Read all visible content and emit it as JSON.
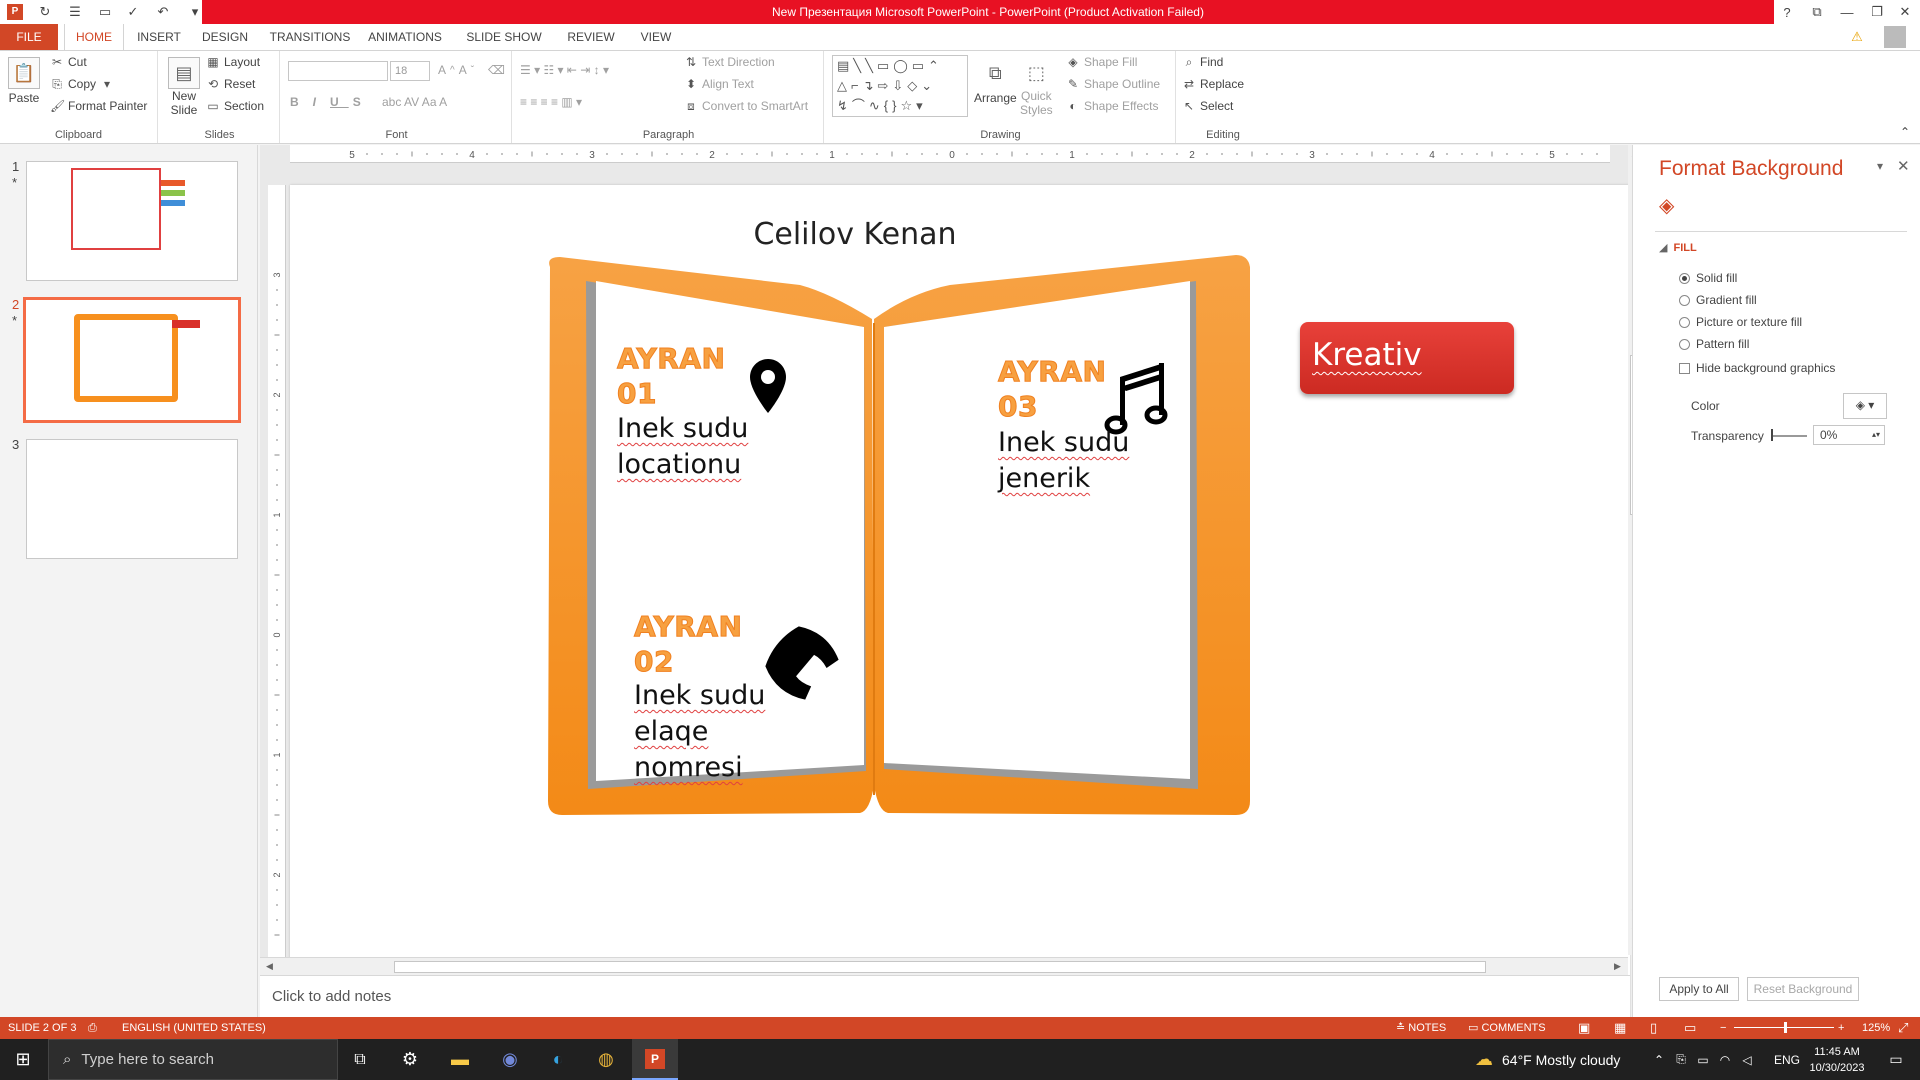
{
  "app": {
    "title": "New Презентация Microsoft PowerPoint - PowerPoint (Product Activation Failed)"
  },
  "tabs": [
    "FILE",
    "HOME",
    "INSERT",
    "DESIGN",
    "TRANSITIONS",
    "ANIMATIONS",
    "SLIDE SHOW",
    "REVIEW",
    "VIEW"
  ],
  "ribbon": {
    "clipboard": {
      "label": "Clipboard",
      "paste": "Paste",
      "cut": "Cut",
      "copy": "Copy",
      "format_painter": "Format Painter"
    },
    "slides": {
      "label": "Slides",
      "new_slide": "New",
      "new_slide2": "Slide",
      "layout": "Layout",
      "reset": "Reset",
      "section": "Section"
    },
    "font": {
      "label": "Font",
      "size": "18"
    },
    "paragraph": {
      "label": "Paragraph",
      "text_direction": "Text Direction",
      "align_text": "Align Text",
      "convert_smartart": "Convert to SmartArt"
    },
    "drawing": {
      "label": "Drawing",
      "arrange": "Arrange",
      "quick_styles": "Quick",
      "quick_styles2": "Styles",
      "shape_fill": "Shape Fill",
      "shape_outline": "Shape Outline",
      "shape_effects": "Shape Effects"
    },
    "editing": {
      "label": "Editing",
      "find": "Find",
      "replace": "Replace",
      "select": "Select"
    }
  },
  "thumbnails": [
    {
      "num": "1",
      "star": "*"
    },
    {
      "num": "2",
      "star": "*"
    },
    {
      "num": "3",
      "star": ""
    }
  ],
  "slide": {
    "title": "Celilov Kenan",
    "items": [
      {
        "heading1": "AYRAN",
        "heading2": "01",
        "line1": "Inek sudu",
        "line2": "locationu",
        "line3": ""
      },
      {
        "heading1": "AYRAN",
        "heading2": "02",
        "line1": "Inek sudu",
        "line2": "elaqe",
        "line3": "nomresi"
      },
      {
        "heading1": "AYRAN",
        "heading2": "03",
        "line1": "Inek sudu",
        "line2": "jenerik",
        "line3": ""
      }
    ],
    "tag": "Kreativ"
  },
  "ruler": {
    "h_ticks": [
      "5",
      "4",
      "3",
      "2",
      "1",
      "0",
      "1",
      "2",
      "3",
      "4",
      "5"
    ],
    "v_ticks": [
      "3",
      "2",
      "1",
      "0",
      "1",
      "2"
    ]
  },
  "notes": {
    "placeholder": "Click to add notes"
  },
  "format_pane": {
    "title": "Format Background",
    "section": "FILL",
    "options": [
      "Solid fill",
      "Gradient fill",
      "Picture or texture fill",
      "Pattern fill"
    ],
    "hide_bg": "Hide background graphics",
    "color_label": "Color",
    "transparency_label": "Transparency",
    "transparency_value": "0%",
    "apply_all": "Apply to All",
    "reset_bg": "Reset Background"
  },
  "status": {
    "slide_info": "SLIDE 2 OF 3",
    "language": "ENGLISH (UNITED STATES)",
    "notes": "NOTES",
    "comments": "COMMENTS",
    "zoom": "125%"
  },
  "taskbar": {
    "search_placeholder": "Type here to search",
    "weather": "64°F  Mostly cloudy",
    "lang": "ENG",
    "time": "11:45 AM",
    "date": "10/30/2023"
  },
  "colors": {
    "accent": "#d24726",
    "title_red": "#e81123",
    "book_orange": "#f7901e",
    "tag_red": "#d9302a"
  }
}
